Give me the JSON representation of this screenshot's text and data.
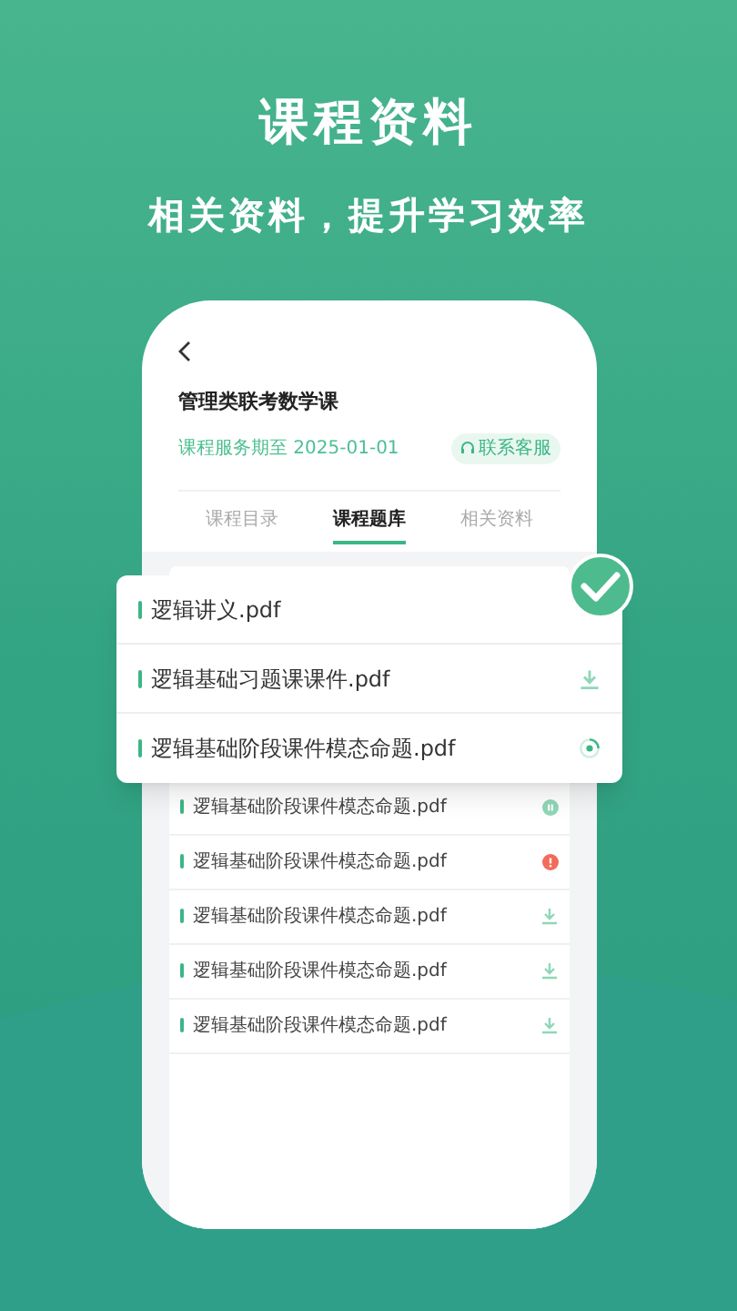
{
  "headline": "课程资料",
  "tagline": "相关资料，提升学习效率",
  "course": {
    "title": "管理类联考数学课",
    "expiry": "课程服务期至 2025-01-01",
    "contact": "联系客服"
  },
  "tabs": [
    {
      "label": "课程目录",
      "selected": false
    },
    {
      "label": "课程题库",
      "selected": true
    },
    {
      "label": "相关资料",
      "selected": false
    }
  ],
  "popup_files": [
    {
      "name": "逻辑讲义.pdf",
      "kind": "done"
    },
    {
      "name": "逻辑基础习题课课件.pdf",
      "kind": "download"
    },
    {
      "name": "逻辑基础阶段课件模态命题.pdf",
      "kind": "progress"
    }
  ],
  "files": [
    {
      "name": "逻辑基础阶段课件模态命题.pdf",
      "kind": "paused"
    },
    {
      "name": "逻辑基础阶段课件模态命题.pdf",
      "kind": "error"
    },
    {
      "name": "逻辑基础阶段课件模态命题.pdf",
      "kind": "download"
    },
    {
      "name": "逻辑基础阶段课件模态命题.pdf",
      "kind": "download"
    },
    {
      "name": "逻辑基础阶段课件模态命题.pdf",
      "kind": "download"
    }
  ]
}
